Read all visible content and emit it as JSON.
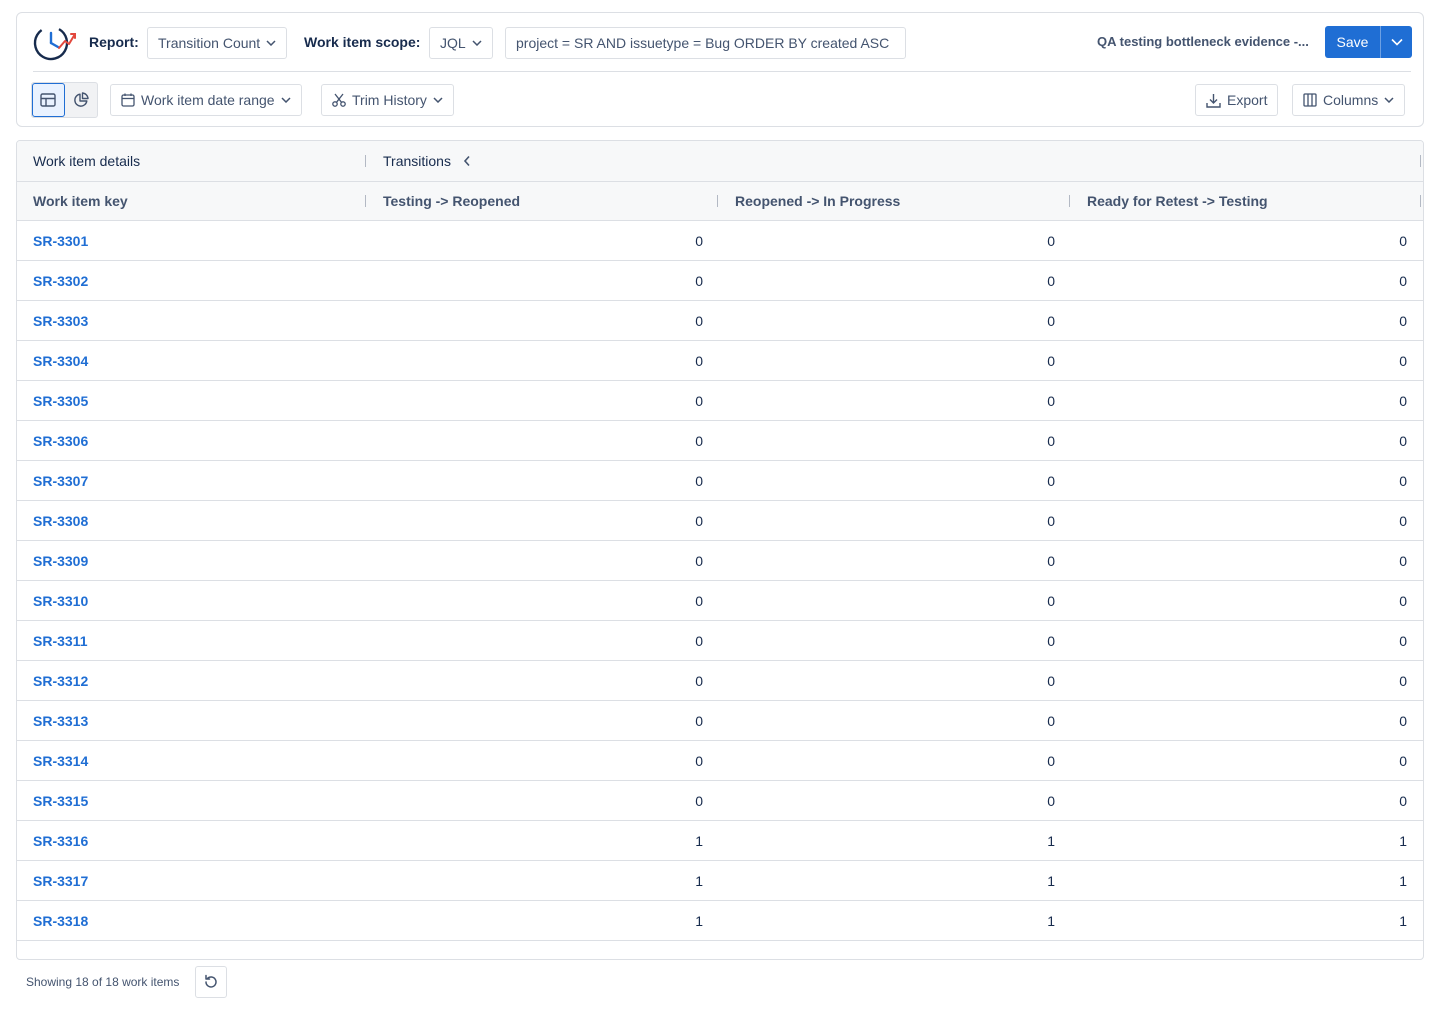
{
  "header": {
    "report_label": "Report:",
    "report_value": "Transition Count",
    "scope_label": "Work item scope:",
    "scope_value": "JQL",
    "jql_query": "project = SR AND issuetype = Bug ORDER BY created ASC",
    "report_name": "QA testing bottleneck evidence -...",
    "save_label": "Save"
  },
  "toolbar": {
    "date_range_label": "Work item date range",
    "trim_history_label": "Trim History",
    "export_label": "Export",
    "columns_label": "Columns"
  },
  "table": {
    "group_headers": {
      "details": "Work item details",
      "transitions": "Transitions"
    },
    "columns": [
      "Work item key",
      "Testing -> Reopened",
      "Reopened -> In Progress",
      "Ready for Retest -> Testing"
    ],
    "rows": [
      {
        "key": "SR-3301",
        "values": [
          "0",
          "0",
          "0"
        ]
      },
      {
        "key": "SR-3302",
        "values": [
          "0",
          "0",
          "0"
        ]
      },
      {
        "key": "SR-3303",
        "values": [
          "0",
          "0",
          "0"
        ]
      },
      {
        "key": "SR-3304",
        "values": [
          "0",
          "0",
          "0"
        ]
      },
      {
        "key": "SR-3305",
        "values": [
          "0",
          "0",
          "0"
        ]
      },
      {
        "key": "SR-3306",
        "values": [
          "0",
          "0",
          "0"
        ]
      },
      {
        "key": "SR-3307",
        "values": [
          "0",
          "0",
          "0"
        ]
      },
      {
        "key": "SR-3308",
        "values": [
          "0",
          "0",
          "0"
        ]
      },
      {
        "key": "SR-3309",
        "values": [
          "0",
          "0",
          "0"
        ]
      },
      {
        "key": "SR-3310",
        "values": [
          "0",
          "0",
          "0"
        ]
      },
      {
        "key": "SR-3311",
        "values": [
          "0",
          "0",
          "0"
        ]
      },
      {
        "key": "SR-3312",
        "values": [
          "0",
          "0",
          "0"
        ]
      },
      {
        "key": "SR-3313",
        "values": [
          "0",
          "0",
          "0"
        ]
      },
      {
        "key": "SR-3314",
        "values": [
          "0",
          "0",
          "0"
        ]
      },
      {
        "key": "SR-3315",
        "values": [
          "0",
          "0",
          "0"
        ]
      },
      {
        "key": "SR-3316",
        "values": [
          "1",
          "1",
          "1"
        ]
      },
      {
        "key": "SR-3317",
        "values": [
          "1",
          "1",
          "1"
        ]
      },
      {
        "key": "SR-3318",
        "values": [
          "1",
          "1",
          "1"
        ]
      }
    ]
  },
  "footer": {
    "status_text": "Showing 18 of 18 work items"
  },
  "colors": {
    "accent": "#1f6ed4",
    "link": "#1f6ed4",
    "border": "#dcdfe4",
    "header_bg": "#f7f8f9"
  },
  "icons": {
    "logo": "clock-chart-logo-icon",
    "table_view": "table-icon",
    "chart_view": "pie-chart-icon",
    "date_range": "calendar-icon",
    "trim": "scissors-icon",
    "export": "download-icon",
    "columns": "columns-icon",
    "collapse": "chevron-left-icon",
    "refresh": "refresh-icon"
  }
}
